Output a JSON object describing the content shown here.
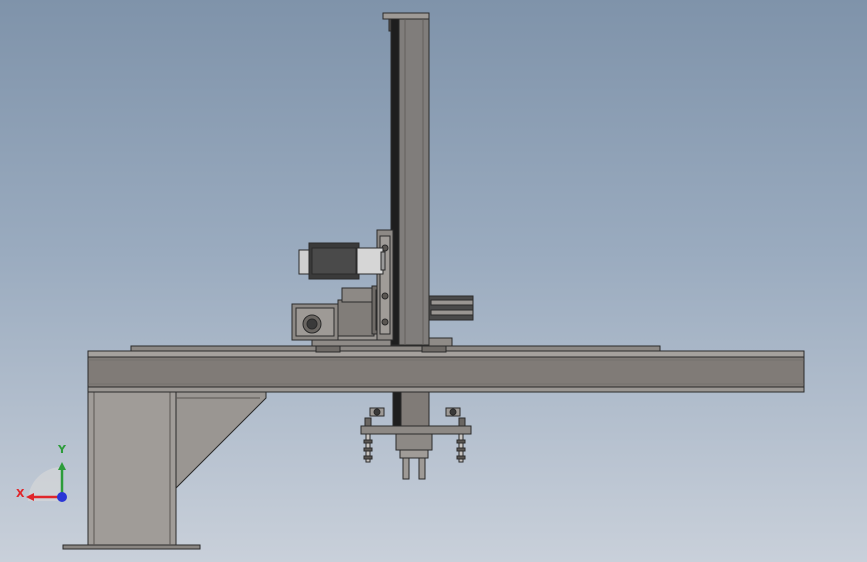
{
  "viewport": {
    "background_top": "#7f93aa",
    "background_bottom": "#c9d0da"
  },
  "model": {
    "name": "gantry-manipulator",
    "colors": {
      "steel": "#807b77",
      "steel_light": "#9c9894",
      "steel_dark": "#5f5b58",
      "outline": "#2a2a2a",
      "motor_body": "#3a3a3a",
      "motor_shaft": "#d6d6d6",
      "column_slot": "#1e1e1e"
    }
  },
  "triad": {
    "x_label": "X",
    "y_label": "Y",
    "x_color": "#e0262a",
    "y_color": "#2c9c3a",
    "z_color": "#2a36d6",
    "icon": "coordinate-triad-icon"
  }
}
